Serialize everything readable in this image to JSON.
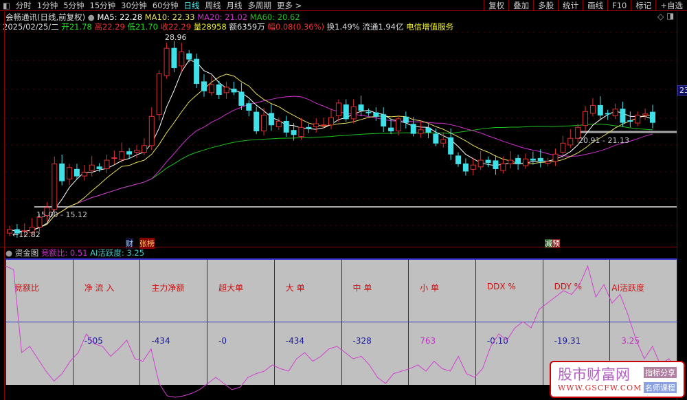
{
  "toolbar": {
    "items": [
      "分时",
      "1分钟",
      "5分钟",
      "15分钟",
      "30分钟",
      "60分钟",
      "日线",
      "周线",
      "月线",
      "多周期",
      "更多 >"
    ],
    "active": "日线",
    "right": [
      "复权",
      "叠加",
      "多股",
      "统计",
      "画线",
      "F10",
      "标记",
      "+自选"
    ]
  },
  "info": {
    "title": "会畅通讯(日线,前复权)",
    "ma5": "MA5: 22.28",
    "ma10": "MA10: 22.33",
    "ma20": "MA20: 21.02",
    "ma60": "MA60: 20.62",
    "date": "2025/02/25/二",
    "open": "开21.78",
    "high": "高22.29",
    "low": "低21.70",
    "close": "收22.29",
    "vol": "量28958",
    "amount": "额6359万",
    "change": "幅0.08(0.36%)",
    "turnover": "换1.49%",
    "float": "流通1.94亿",
    "industry": "电信增值服务"
  },
  "annotations": {
    "max": "28.96",
    "min": "←12.82",
    "range_high": "20.91 - 21.13",
    "range_low": "15.00 - 15.12",
    "tag_fin": "财",
    "tag_zhang": "张榜",
    "tag_jian": "减",
    "tag_yu": "预"
  },
  "right_axis": {
    "price": "23."
  },
  "colors": {
    "up": "#e03030",
    "down": "#40e0e8",
    "ma5": "#ffffff",
    "ma10": "#e8e060",
    "ma20": "#d030d0",
    "ma60": "#20c020"
  },
  "lower": {
    "title": "资金图",
    "jeb": "竞额比: 0.51",
    "ai": "AI活跃度: 3.25",
    "columns": [
      {
        "label": "竞额比",
        "value": ""
      },
      {
        "label": "净 流 入",
        "value": "-505"
      },
      {
        "label": "主力净额",
        "value": "-434"
      },
      {
        "label": "超大单",
        "value": "-0"
      },
      {
        "label": "大  单",
        "value": "-434"
      },
      {
        "label": "中  单",
        "value": "-328"
      },
      {
        "label": "小  单",
        "value": "763"
      },
      {
        "label": "DDX %",
        "value": "-0.10"
      },
      {
        "label": "DDY %",
        "value": "-19.31"
      },
      {
        "label": "AI活跃度",
        "value": "3.25"
      }
    ]
  },
  "watermark": {
    "name": "股市财富网",
    "url": "WWW.GSCFW.COM",
    "tag1": "指标分享",
    "tag2": "名师课程"
  },
  "chart_data": {
    "type": "candlestick",
    "closes": [
      13.2,
      12.9,
      13.1,
      13.4,
      14.2,
      15.0,
      18.6,
      17.2,
      18.3,
      17.6,
      17.9,
      18.5,
      18.2,
      18.9,
      19.1,
      19.6,
      19.4,
      19.7,
      20.1,
      22.5,
      26.0,
      28.1,
      26.5,
      27.8,
      27.2,
      25.2,
      24.6,
      25.1,
      24.3,
      24.9,
      24.5,
      23.4,
      23.0,
      21.3,
      22.6,
      21.8,
      22.1,
      21.2,
      21.0,
      21.6,
      21.5,
      21.9,
      21.8,
      22.4,
      23.6,
      22.3,
      23.3,
      23.0,
      22.8,
      22.5,
      21.7,
      21.3,
      22.3,
      22.0,
      21.1,
      21.4,
      21.2,
      20.3,
      20.6,
      19.4,
      18.6,
      18.0,
      18.5,
      18.9,
      18.7,
      18.2,
      18.6,
      18.9,
      18.6,
      19.0,
      18.9,
      18.8,
      18.8,
      19.4,
      20.3,
      20.7,
      21.6,
      22.9,
      23.4,
      22.6,
      22.7,
      23.1,
      22.0,
      22.1,
      22.6,
      22.7,
      22.0
    ],
    "lower_series": {
      "name": "竞额比",
      "values": [
        95,
        92,
        25,
        30,
        20,
        10,
        2,
        8,
        18,
        25,
        40,
        32,
        30,
        22,
        28,
        35,
        20,
        18,
        28,
        0,
        -10,
        -12,
        -10,
        -8,
        -5,
        0,
        5,
        0,
        -5,
        -3,
        5,
        8,
        10,
        15,
        12,
        10,
        20,
        25,
        18,
        22,
        28,
        30,
        25,
        20,
        22,
        15,
        5,
        0,
        8,
        10,
        12,
        15,
        10,
        18,
        12,
        10,
        22,
        8,
        5,
        12,
        30,
        40,
        35,
        45,
        50,
        45,
        60,
        65,
        70,
        75,
        72,
        80,
        95,
        70,
        80,
        65,
        72,
        55,
        35,
        20,
        30,
        15,
        20,
        12
      ]
    }
  }
}
